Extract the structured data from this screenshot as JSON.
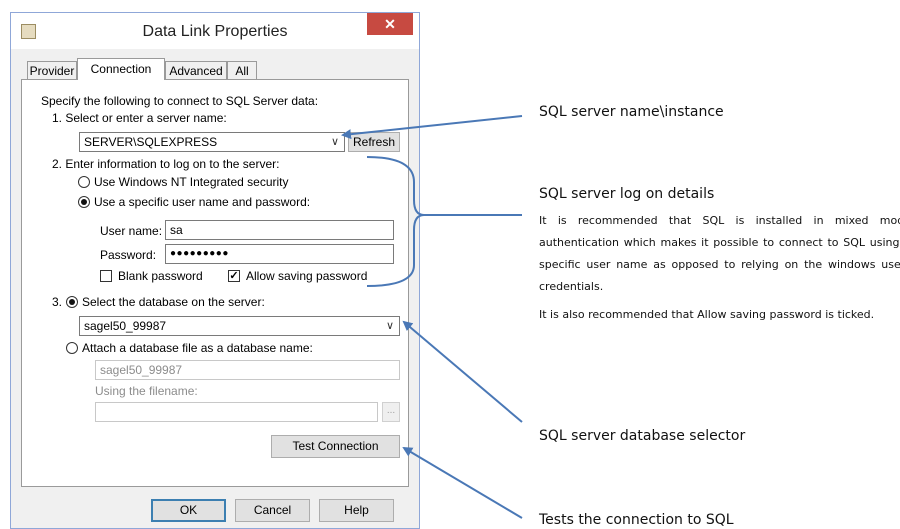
{
  "window": {
    "title": "Data Link Properties",
    "close_glyph": "✕"
  },
  "tabs": [
    "Provider",
    "Connection",
    "Advanced",
    "All"
  ],
  "connection": {
    "intro": "Specify the following to connect to SQL Server data:",
    "step1_label": "1. Select or enter a server name:",
    "server_value": "SERVER\\SQLEXPRESS",
    "refresh_label": "Refresh",
    "step2_label": "2. Enter information to log on to the server:",
    "radio_nt": "Use Windows NT Integrated security",
    "radio_specific": "Use a specific user name and password:",
    "username_label": "User name:",
    "username_value": "sa",
    "password_label": "Password:",
    "password_value": "●●●●●●●●●",
    "blank_password": "Blank password",
    "allow_saving": "Allow saving password",
    "check_mark": "✓",
    "step3_label": "3.",
    "select_db_label": "Select the database on the server:",
    "database_value": "sagel50_99987",
    "attach_label": "Attach a database file as a database name:",
    "attach_value": "sagel50_99987",
    "filename_label": "Using the filename:",
    "browse_label": "...",
    "test_label": "Test Connection"
  },
  "footer": {
    "ok": "OK",
    "cancel": "Cancel",
    "help": "Help"
  },
  "annotations": {
    "server_name": "SQL server name\\instance",
    "logon_title": "SQL server log on details",
    "logon_p1": "It is recommended that SQL is installed in mixed mode authentication which makes it possible to connect to SQL using a specific user name as opposed to relying on the windows users credentials.",
    "logon_p2": "It is also recommended that Allow saving password is ticked.",
    "db_selector": "SQL server database selector",
    "test_conn": "Tests the connection to SQL"
  },
  "colors": {
    "arrow": "#4a78b6",
    "close_bg": "#c74a41",
    "window_border": "#8fa7d8"
  }
}
